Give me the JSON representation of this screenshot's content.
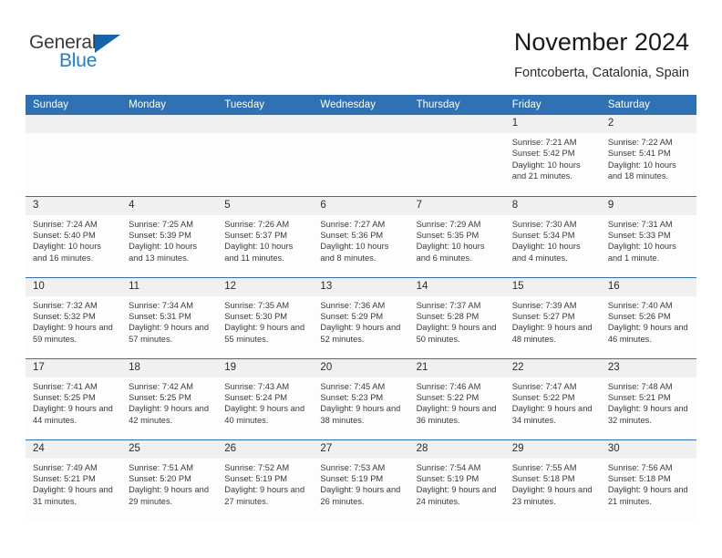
{
  "brand": {
    "name_part1": "General",
    "name_part2": "Blue",
    "accent_color": "#1c7fd0",
    "triangle_color": "#1565a8",
    "triangle_icon": "triangle-icon"
  },
  "header": {
    "title": "November 2024",
    "subtitle": "Fontcoberta, Catalonia, Spain",
    "header_bg": "#3071b4",
    "daynum_bg": "#f0f0f0"
  },
  "weekdays": [
    "Sunday",
    "Monday",
    "Tuesday",
    "Wednesday",
    "Thursday",
    "Friday",
    "Saturday"
  ],
  "weeks": [
    [
      {
        "day": "",
        "blank": true
      },
      {
        "day": "",
        "blank": true
      },
      {
        "day": "",
        "blank": true
      },
      {
        "day": "",
        "blank": true
      },
      {
        "day": "",
        "blank": true
      },
      {
        "day": "1",
        "sunrise": "Sunrise: 7:21 AM",
        "sunset": "Sunset: 5:42 PM",
        "daylight": "Daylight: 10 hours and 21 minutes."
      },
      {
        "day": "2",
        "sunrise": "Sunrise: 7:22 AM",
        "sunset": "Sunset: 5:41 PM",
        "daylight": "Daylight: 10 hours and 18 minutes."
      }
    ],
    [
      {
        "day": "3",
        "sunrise": "Sunrise: 7:24 AM",
        "sunset": "Sunset: 5:40 PM",
        "daylight": "Daylight: 10 hours and 16 minutes."
      },
      {
        "day": "4",
        "sunrise": "Sunrise: 7:25 AM",
        "sunset": "Sunset: 5:39 PM",
        "daylight": "Daylight: 10 hours and 13 minutes."
      },
      {
        "day": "5",
        "sunrise": "Sunrise: 7:26 AM",
        "sunset": "Sunset: 5:37 PM",
        "daylight": "Daylight: 10 hours and 11 minutes."
      },
      {
        "day": "6",
        "sunrise": "Sunrise: 7:27 AM",
        "sunset": "Sunset: 5:36 PM",
        "daylight": "Daylight: 10 hours and 8 minutes."
      },
      {
        "day": "7",
        "sunrise": "Sunrise: 7:29 AM",
        "sunset": "Sunset: 5:35 PM",
        "daylight": "Daylight: 10 hours and 6 minutes."
      },
      {
        "day": "8",
        "sunrise": "Sunrise: 7:30 AM",
        "sunset": "Sunset: 5:34 PM",
        "daylight": "Daylight: 10 hours and 4 minutes."
      },
      {
        "day": "9",
        "sunrise": "Sunrise: 7:31 AM",
        "sunset": "Sunset: 5:33 PM",
        "daylight": "Daylight: 10 hours and 1 minute."
      }
    ],
    [
      {
        "day": "10",
        "sunrise": "Sunrise: 7:32 AM",
        "sunset": "Sunset: 5:32 PM",
        "daylight": "Daylight: 9 hours and 59 minutes."
      },
      {
        "day": "11",
        "sunrise": "Sunrise: 7:34 AM",
        "sunset": "Sunset: 5:31 PM",
        "daylight": "Daylight: 9 hours and 57 minutes."
      },
      {
        "day": "12",
        "sunrise": "Sunrise: 7:35 AM",
        "sunset": "Sunset: 5:30 PM",
        "daylight": "Daylight: 9 hours and 55 minutes."
      },
      {
        "day": "13",
        "sunrise": "Sunrise: 7:36 AM",
        "sunset": "Sunset: 5:29 PM",
        "daylight": "Daylight: 9 hours and 52 minutes."
      },
      {
        "day": "14",
        "sunrise": "Sunrise: 7:37 AM",
        "sunset": "Sunset: 5:28 PM",
        "daylight": "Daylight: 9 hours and 50 minutes."
      },
      {
        "day": "15",
        "sunrise": "Sunrise: 7:39 AM",
        "sunset": "Sunset: 5:27 PM",
        "daylight": "Daylight: 9 hours and 48 minutes."
      },
      {
        "day": "16",
        "sunrise": "Sunrise: 7:40 AM",
        "sunset": "Sunset: 5:26 PM",
        "daylight": "Daylight: 9 hours and 46 minutes."
      }
    ],
    [
      {
        "day": "17",
        "sunrise": "Sunrise: 7:41 AM",
        "sunset": "Sunset: 5:25 PM",
        "daylight": "Daylight: 9 hours and 44 minutes."
      },
      {
        "day": "18",
        "sunrise": "Sunrise: 7:42 AM",
        "sunset": "Sunset: 5:25 PM",
        "daylight": "Daylight: 9 hours and 42 minutes."
      },
      {
        "day": "19",
        "sunrise": "Sunrise: 7:43 AM",
        "sunset": "Sunset: 5:24 PM",
        "daylight": "Daylight: 9 hours and 40 minutes."
      },
      {
        "day": "20",
        "sunrise": "Sunrise: 7:45 AM",
        "sunset": "Sunset: 5:23 PM",
        "daylight": "Daylight: 9 hours and 38 minutes."
      },
      {
        "day": "21",
        "sunrise": "Sunrise: 7:46 AM",
        "sunset": "Sunset: 5:22 PM",
        "daylight": "Daylight: 9 hours and 36 minutes."
      },
      {
        "day": "22",
        "sunrise": "Sunrise: 7:47 AM",
        "sunset": "Sunset: 5:22 PM",
        "daylight": "Daylight: 9 hours and 34 minutes."
      },
      {
        "day": "23",
        "sunrise": "Sunrise: 7:48 AM",
        "sunset": "Sunset: 5:21 PM",
        "daylight": "Daylight: 9 hours and 32 minutes."
      }
    ],
    [
      {
        "day": "24",
        "sunrise": "Sunrise: 7:49 AM",
        "sunset": "Sunset: 5:21 PM",
        "daylight": "Daylight: 9 hours and 31 minutes."
      },
      {
        "day": "25",
        "sunrise": "Sunrise: 7:51 AM",
        "sunset": "Sunset: 5:20 PM",
        "daylight": "Daylight: 9 hours and 29 minutes."
      },
      {
        "day": "26",
        "sunrise": "Sunrise: 7:52 AM",
        "sunset": "Sunset: 5:19 PM",
        "daylight": "Daylight: 9 hours and 27 minutes."
      },
      {
        "day": "27",
        "sunrise": "Sunrise: 7:53 AM",
        "sunset": "Sunset: 5:19 PM",
        "daylight": "Daylight: 9 hours and 26 minutes."
      },
      {
        "day": "28",
        "sunrise": "Sunrise: 7:54 AM",
        "sunset": "Sunset: 5:19 PM",
        "daylight": "Daylight: 9 hours and 24 minutes."
      },
      {
        "day": "29",
        "sunrise": "Sunrise: 7:55 AM",
        "sunset": "Sunset: 5:18 PM",
        "daylight": "Daylight: 9 hours and 23 minutes."
      },
      {
        "day": "30",
        "sunrise": "Sunrise: 7:56 AM",
        "sunset": "Sunset: 5:18 PM",
        "daylight": "Daylight: 9 hours and 21 minutes."
      }
    ]
  ]
}
